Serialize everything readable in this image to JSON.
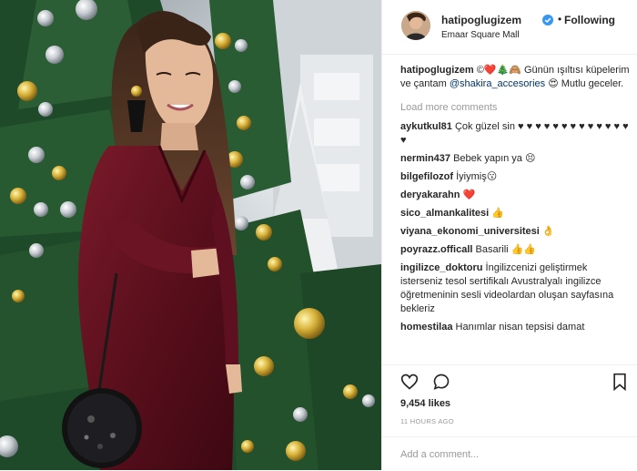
{
  "header": {
    "username": "hatipoglugizem",
    "follow_status": "Following",
    "location": "Emaar Square Mall"
  },
  "caption": {
    "username": "hatipoglugizem",
    "text_a": "©❤️🎄🙈 Günün ışıltısı küpelerim ve çantam",
    "mention": "@shakira_accesories",
    "text_b": "😍 Mutlu geceler."
  },
  "load_more": "Load more comments",
  "comments": [
    {
      "user": "aykutkul81",
      "text": "Çok güzel sin ♥ ♥ ♥ ♥ ♥ ♥ ♥ ♥ ♥ ♥ ♥ ♥ ♥ ♥"
    },
    {
      "user": "nermin437",
      "text": "Bebek yapın ya 😣"
    },
    {
      "user": "bilgefilozof",
      "text": "İyiymiş😗"
    },
    {
      "user": "deryakarahn",
      "text": "❤️"
    },
    {
      "user": "sico_almankalitesi",
      "text": "👍"
    },
    {
      "user": "viyana_ekonomi_universitesi",
      "text": "👌"
    },
    {
      "user": "poyrazz.officall",
      "text": "Basarili 👍👍"
    },
    {
      "user": "ingilizce_doktoru",
      "text": "İngilizcenizi geliştirmek isterseniz tesol sertifikalı Avustralyalı ingilizce öğretmeninin sesli videolardan oluşan sayfasına bekleriz"
    },
    {
      "user": "homestilaa",
      "text": "Hanımlar nisan tepsisi damat"
    }
  ],
  "likes": "9,454 likes",
  "timestamp": "11 HOURS AGO",
  "add_comment_placeholder": "Add a comment...",
  "icons": {
    "like": "heart-icon",
    "comment": "comment-bubble-icon",
    "save": "bookmark-icon",
    "verified": "verified-badge-icon"
  },
  "colors": {
    "verified": "#3897f0",
    "link": "#003569",
    "muted": "#999999",
    "dress": "#5a0f1c"
  }
}
